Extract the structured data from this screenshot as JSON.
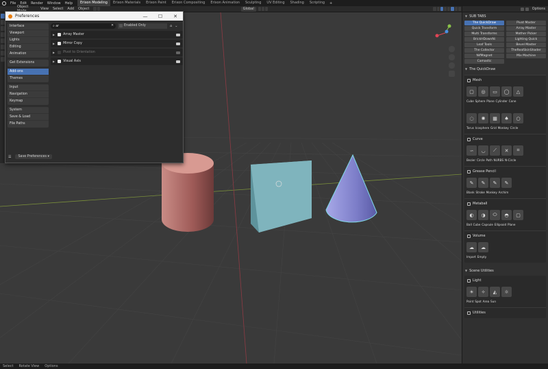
{
  "topbar": {
    "menus": [
      "File",
      "Edit",
      "Render",
      "Window",
      "Help"
    ],
    "workspaces": [
      "Erixon Modeling",
      "Erixon Materials",
      "Erixon Paint",
      "Erixon Compositing",
      "Erixon Animation",
      "Sculpting",
      "UV Editing",
      "Shading",
      "Scripting"
    ],
    "add_tab": "+"
  },
  "header": {
    "mode": "Object Mode",
    "menus": [
      "View",
      "Select",
      "Add",
      "Object"
    ],
    "orientation": "Global"
  },
  "preferences": {
    "title": "Preferences",
    "nav_groups": [
      [
        "Interface",
        "Viewport",
        "Lights",
        "Editing",
        "Animation"
      ],
      [
        "Get Extensions"
      ],
      [
        "Add-ons",
        "Themes"
      ],
      [
        "Input",
        "Navigation",
        "Keymap"
      ],
      [
        "System",
        "Save & Load",
        "File Paths"
      ]
    ],
    "active_nav": "Add-ons",
    "search_value": "ar",
    "enabled_only_label": "Enabled Only",
    "addons": [
      {
        "name": "Array Master",
        "enabled": true
      },
      {
        "name": "Mirror Copy",
        "enabled": true
      },
      {
        "name": "Pivot to Orientation",
        "enabled": false
      },
      {
        "name": "Visual Axis",
        "enabled": true
      }
    ],
    "save_label": "Save Preferences"
  },
  "right_panel": {
    "options_label": "Options",
    "sub_tabs_title": "SUB TABS",
    "tabs": [
      "The QuickDraw",
      "Pivot Master",
      "Quick Transform",
      "Array Master",
      "Multi Transforms",
      "Mother Picker",
      "BrickHDownNi",
      "Lighting Quick",
      "Leaf Tools",
      "Bevel Master",
      "The Collector",
      "TheRealSkinShader",
      "NifMagnet",
      "Mix Machine",
      "Camastic"
    ],
    "active_tab": "The QuickDraw",
    "quickdraw_title": "The QuickDraw",
    "groups": [
      {
        "title": "Mesh",
        "icon": "mesh-icon",
        "rows": [
          {
            "icons": [
              "▢",
              "◎",
              "▭",
              "◯",
              "△"
            ],
            "label": "Cube Sphere Plane Cylinder Cone"
          },
          {
            "icons": [
              "◌",
              "✺",
              "▦",
              "♠",
              "○"
            ],
            "label": "Torus Icosphere Grid Monkey Circle"
          }
        ]
      },
      {
        "title": "Curve",
        "icon": "curve-icon",
        "rows": [
          {
            "icons": [
              "∽",
              "◡",
              "⟋",
              "✕",
              "⌗"
            ],
            "label": "Bezier Circle Path NURBS N-Circle"
          }
        ]
      },
      {
        "title": "Grease Pencil",
        "icon": "pencil-icon",
        "rows": [
          {
            "icons": [
              "✎",
              "✎",
              "✎",
              "✎"
            ],
            "label": "Blank Stroke Monkey Archim"
          }
        ]
      },
      {
        "title": "Metaball",
        "icon": "metaball-icon",
        "rows": [
          {
            "icons": [
              "◐",
              "◑",
              "⬭",
              "◓",
              "▢"
            ],
            "label": "Ball Cube Capsule Ellipsoid Plane"
          }
        ]
      },
      {
        "title": "Volume",
        "icon": "volume-icon",
        "rows": [
          {
            "icons": [
              "☁",
              "☁"
            ],
            "label": "Import Empty"
          }
        ]
      }
    ],
    "scene_utilities_title": "Scene Utilities",
    "light_group": {
      "title": "Light",
      "icons": [
        "☀",
        "✧",
        "◭",
        "☼"
      ],
      "label": "Point Spot Area Sun"
    },
    "utilities_title": "Utilities"
  },
  "status": {
    "items": [
      "Select",
      "Rotate View",
      "Options"
    ]
  },
  "colors": {
    "accent": "#4772b3",
    "cylinder": "#c77a76",
    "cube": "#7fb4bd",
    "cone": "#8d8ed6"
  }
}
